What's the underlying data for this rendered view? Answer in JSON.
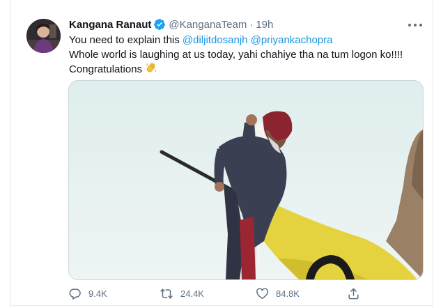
{
  "tweet": {
    "author_name": "Kangana Ranaut",
    "handle": "@KanganaTeam",
    "separator": "·",
    "time": "19h",
    "text": {
      "line1_prefix": "You need to explain this ",
      "mention1": "@diljitdosanjh",
      "mention2": "@priyankachopra",
      "line2": "Whole world is laughing at us today, yahi chahiye tha na tum logon ko!!!!",
      "line3": "Congratulations"
    },
    "emoji": "clapping-hands"
  },
  "actions": {
    "replies": "9.4K",
    "retweets": "24.4K",
    "likes": "84.8K"
  },
  "colors": {
    "link": "#1b95e0",
    "verified": "#1da1f2",
    "muted": "#5b7083"
  },
  "icons": [
    "verified-badge-icon",
    "more-options-icon",
    "reply-icon",
    "retweet-icon",
    "like-icon",
    "share-icon",
    "clap-emoji-icon"
  ]
}
